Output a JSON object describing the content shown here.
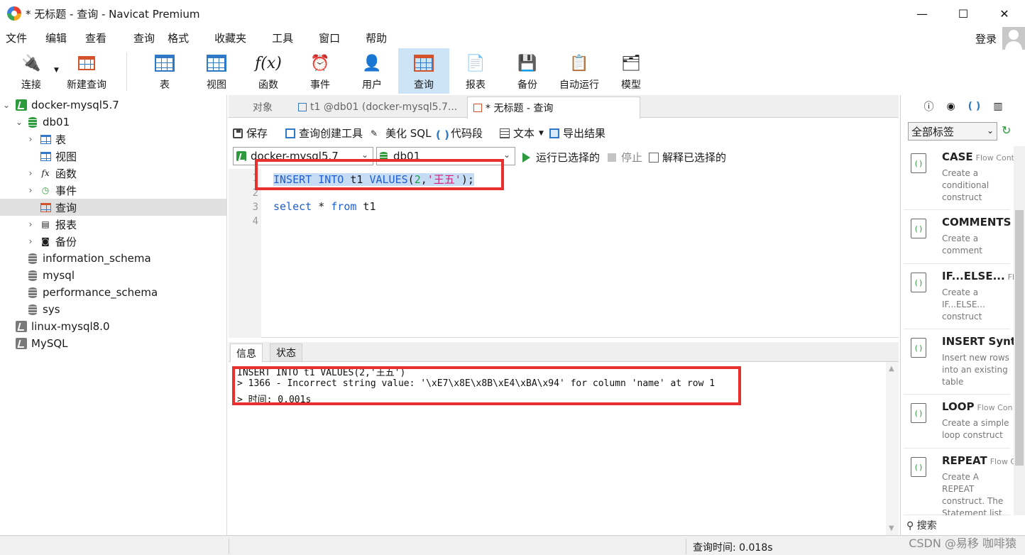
{
  "window": {
    "title": "* 无标题 - 查询 - Navicat Premium",
    "minimize": "—",
    "maximize": "☐",
    "close": "✕"
  },
  "menu": [
    "文件",
    "编辑",
    "查看",
    "查询",
    "格式",
    "收藏夹",
    "工具",
    "窗口",
    "帮助"
  ],
  "login": "登录",
  "toolbar": {
    "connect": "连接",
    "new_query": "新建查询",
    "table": "表",
    "view": "视图",
    "function": "函数",
    "event": "事件",
    "user": "用户",
    "query": "查询",
    "report": "报表",
    "backup": "备份",
    "automation": "自动运行",
    "model": "模型"
  },
  "tree": {
    "conn1": "docker-mysql5.7",
    "db1": "db01",
    "items": [
      "表",
      "视图",
      "函数",
      "事件",
      "查询",
      "报表",
      "备份"
    ],
    "dbs": [
      "information_schema",
      "mysql",
      "performance_schema",
      "sys"
    ],
    "conn2": "linux-mysql8.0",
    "conn3": "MySQL"
  },
  "tabs": {
    "objects": "对象",
    "table_tab": "t1 @db01 (docker-mysql5.7...",
    "query_tab": "* 无标题 - 查询"
  },
  "editor_toolbar": {
    "save": "保存",
    "builder": "查询创建工具",
    "beautify": "美化 SQL",
    "snippet": "代码段",
    "text": "文本",
    "export": "导出结果"
  },
  "selectors": {
    "connection": "docker-mysql5.7",
    "database": "db01",
    "run_selected": "运行已选择的",
    "stop": "停止",
    "explain": "解释已选择的"
  },
  "code": {
    "line_numbers": [
      "1",
      "2",
      "3",
      "4"
    ],
    "l1_kw": "INSERT INTO",
    "l1_t": " t1 ",
    "l1_values": "VALUES",
    "l1_open": "(",
    "l1_num": "2",
    "l1_comma": ",",
    "l1_str": "'王五'",
    "l1_close": ");",
    "l3_kw1": "select",
    "l3_mid": " * ",
    "l3_kw2": "from",
    "l3_t": " t1"
  },
  "result_tabs": {
    "info": "信息",
    "status": "状态"
  },
  "messages": [
    "INSERT INTO t1 VALUES(2,'王五')",
    "> 1366 - Incorrect string value: '\\xE7\\x8E\\x8B\\xE4\\xBA\\x94' for column 'name' at row 1",
    "> 时间: 0.001s"
  ],
  "right_panel": {
    "tag_filter": "全部标签",
    "snippets": [
      {
        "title": "CASE",
        "category": "Flow Cont",
        "desc": "Create a conditional construct"
      },
      {
        "title": "COMMENTS",
        "category": "",
        "desc": "Create a comment"
      },
      {
        "title": "IF...ELSE...",
        "category": "Flov",
        "desc": "Create a IF...ELSE... construct"
      },
      {
        "title": "INSERT Synta",
        "category": "",
        "desc": "Insert new rows into an existing table"
      },
      {
        "title": "LOOP",
        "category": "Flow Con",
        "desc": "Create a simple loop construct"
      },
      {
        "title": "REPEAT",
        "category": "Flow C",
        "desc": "Create A REPEAT construct. The Statement list is"
      }
    ],
    "search": "搜索"
  },
  "status": {
    "query_time": "查询时间: 0.018s",
    "watermark": "CSDN @易移 咖啡猿"
  }
}
